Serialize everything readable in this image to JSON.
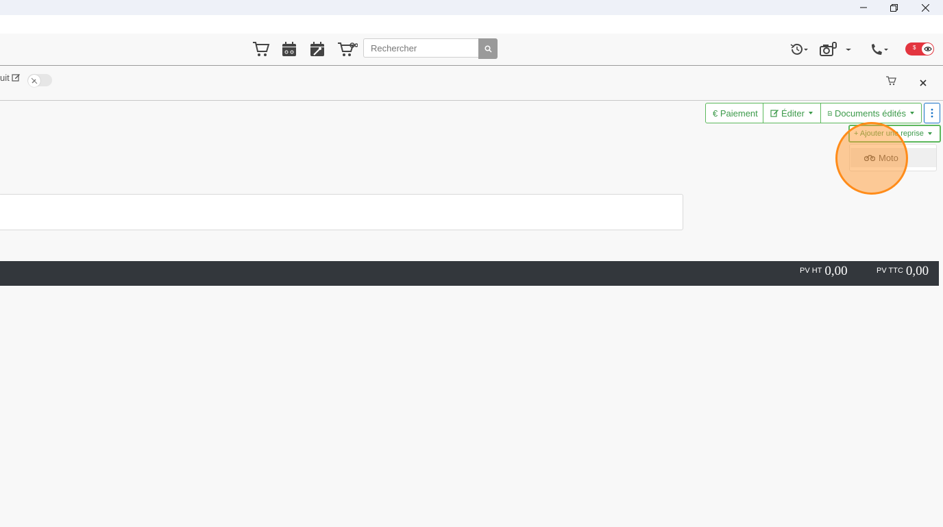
{
  "window": {
    "minimize_icon": "minimize-icon",
    "maximize_icon": "restore-icon",
    "close_icon": "close-icon"
  },
  "navbar": {
    "search": {
      "placeholder": "Rechercher"
    },
    "toggle_label": "$"
  },
  "subbar": {
    "crumb_text": "uit"
  },
  "actions": {
    "paiement": "€ Paiement",
    "editer": "Éditer",
    "documents": "Documents édités",
    "add_reprise": "+ Ajouter une reprise",
    "menu_item": "Moto"
  },
  "totals": {
    "ht_label": "PV HT",
    "ht_value": "0,00",
    "ttc_label": "PV TTC",
    "ttc_value": "0,00"
  },
  "colors": {
    "accent_green": "#5cb85c",
    "toggle_red": "#e3353f",
    "totals_bar": "#33373c",
    "highlight": "#ff8c1a"
  }
}
